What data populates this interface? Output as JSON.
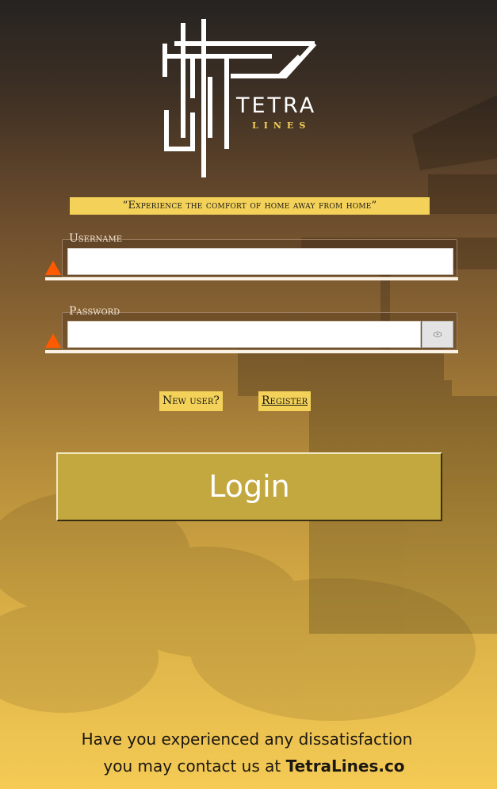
{
  "branding": {
    "logo_name": "TETRA",
    "logo_sub": "LINES",
    "tagline": "“Experience the comfort of home away from home”"
  },
  "form": {
    "username_label": "Username",
    "username_value": "",
    "password_label": "Password",
    "password_value": "",
    "warning_color": "#ff5a00"
  },
  "links": {
    "new_user": "New user?",
    "register": "Register"
  },
  "login_button": "Login",
  "footer": {
    "line1": "Have you experienced any dissatisfaction",
    "line2_prefix": "you may contact us at ",
    "contact": "TetraLines.co"
  },
  "colors": {
    "accent": "#f4d25a",
    "button": "#c2a83f",
    "gradient_top": "#262321",
    "gradient_bottom": "#f5cb55"
  }
}
